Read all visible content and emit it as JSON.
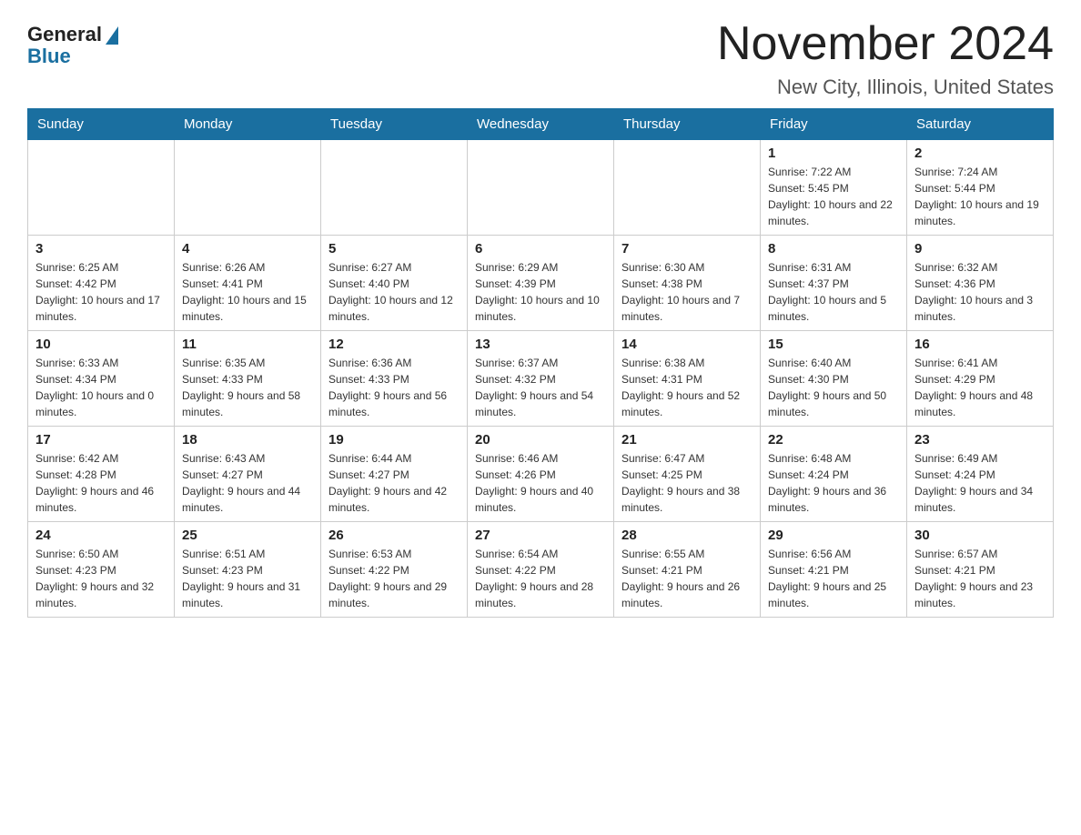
{
  "logo": {
    "general": "General",
    "blue": "Blue"
  },
  "title": "November 2024",
  "subtitle": "New City, Illinois, United States",
  "weekdays": [
    "Sunday",
    "Monday",
    "Tuesday",
    "Wednesday",
    "Thursday",
    "Friday",
    "Saturday"
  ],
  "weeks": [
    [
      {
        "day": "",
        "sunrise": "",
        "sunset": "",
        "daylight": "",
        "empty": true
      },
      {
        "day": "",
        "sunrise": "",
        "sunset": "",
        "daylight": "",
        "empty": true
      },
      {
        "day": "",
        "sunrise": "",
        "sunset": "",
        "daylight": "",
        "empty": true
      },
      {
        "day": "",
        "sunrise": "",
        "sunset": "",
        "daylight": "",
        "empty": true
      },
      {
        "day": "",
        "sunrise": "",
        "sunset": "",
        "daylight": "",
        "empty": true
      },
      {
        "day": "1",
        "sunrise": "Sunrise: 7:22 AM",
        "sunset": "Sunset: 5:45 PM",
        "daylight": "Daylight: 10 hours and 22 minutes.",
        "empty": false
      },
      {
        "day": "2",
        "sunrise": "Sunrise: 7:24 AM",
        "sunset": "Sunset: 5:44 PM",
        "daylight": "Daylight: 10 hours and 19 minutes.",
        "empty": false
      }
    ],
    [
      {
        "day": "3",
        "sunrise": "Sunrise: 6:25 AM",
        "sunset": "Sunset: 4:42 PM",
        "daylight": "Daylight: 10 hours and 17 minutes.",
        "empty": false
      },
      {
        "day": "4",
        "sunrise": "Sunrise: 6:26 AM",
        "sunset": "Sunset: 4:41 PM",
        "daylight": "Daylight: 10 hours and 15 minutes.",
        "empty": false
      },
      {
        "day": "5",
        "sunrise": "Sunrise: 6:27 AM",
        "sunset": "Sunset: 4:40 PM",
        "daylight": "Daylight: 10 hours and 12 minutes.",
        "empty": false
      },
      {
        "day": "6",
        "sunrise": "Sunrise: 6:29 AM",
        "sunset": "Sunset: 4:39 PM",
        "daylight": "Daylight: 10 hours and 10 minutes.",
        "empty": false
      },
      {
        "day": "7",
        "sunrise": "Sunrise: 6:30 AM",
        "sunset": "Sunset: 4:38 PM",
        "daylight": "Daylight: 10 hours and 7 minutes.",
        "empty": false
      },
      {
        "day": "8",
        "sunrise": "Sunrise: 6:31 AM",
        "sunset": "Sunset: 4:37 PM",
        "daylight": "Daylight: 10 hours and 5 minutes.",
        "empty": false
      },
      {
        "day": "9",
        "sunrise": "Sunrise: 6:32 AM",
        "sunset": "Sunset: 4:36 PM",
        "daylight": "Daylight: 10 hours and 3 minutes.",
        "empty": false
      }
    ],
    [
      {
        "day": "10",
        "sunrise": "Sunrise: 6:33 AM",
        "sunset": "Sunset: 4:34 PM",
        "daylight": "Daylight: 10 hours and 0 minutes.",
        "empty": false
      },
      {
        "day": "11",
        "sunrise": "Sunrise: 6:35 AM",
        "sunset": "Sunset: 4:33 PM",
        "daylight": "Daylight: 9 hours and 58 minutes.",
        "empty": false
      },
      {
        "day": "12",
        "sunrise": "Sunrise: 6:36 AM",
        "sunset": "Sunset: 4:33 PM",
        "daylight": "Daylight: 9 hours and 56 minutes.",
        "empty": false
      },
      {
        "day": "13",
        "sunrise": "Sunrise: 6:37 AM",
        "sunset": "Sunset: 4:32 PM",
        "daylight": "Daylight: 9 hours and 54 minutes.",
        "empty": false
      },
      {
        "day": "14",
        "sunrise": "Sunrise: 6:38 AM",
        "sunset": "Sunset: 4:31 PM",
        "daylight": "Daylight: 9 hours and 52 minutes.",
        "empty": false
      },
      {
        "day": "15",
        "sunrise": "Sunrise: 6:40 AM",
        "sunset": "Sunset: 4:30 PM",
        "daylight": "Daylight: 9 hours and 50 minutes.",
        "empty": false
      },
      {
        "day": "16",
        "sunrise": "Sunrise: 6:41 AM",
        "sunset": "Sunset: 4:29 PM",
        "daylight": "Daylight: 9 hours and 48 minutes.",
        "empty": false
      }
    ],
    [
      {
        "day": "17",
        "sunrise": "Sunrise: 6:42 AM",
        "sunset": "Sunset: 4:28 PM",
        "daylight": "Daylight: 9 hours and 46 minutes.",
        "empty": false
      },
      {
        "day": "18",
        "sunrise": "Sunrise: 6:43 AM",
        "sunset": "Sunset: 4:27 PM",
        "daylight": "Daylight: 9 hours and 44 minutes.",
        "empty": false
      },
      {
        "day": "19",
        "sunrise": "Sunrise: 6:44 AM",
        "sunset": "Sunset: 4:27 PM",
        "daylight": "Daylight: 9 hours and 42 minutes.",
        "empty": false
      },
      {
        "day": "20",
        "sunrise": "Sunrise: 6:46 AM",
        "sunset": "Sunset: 4:26 PM",
        "daylight": "Daylight: 9 hours and 40 minutes.",
        "empty": false
      },
      {
        "day": "21",
        "sunrise": "Sunrise: 6:47 AM",
        "sunset": "Sunset: 4:25 PM",
        "daylight": "Daylight: 9 hours and 38 minutes.",
        "empty": false
      },
      {
        "day": "22",
        "sunrise": "Sunrise: 6:48 AM",
        "sunset": "Sunset: 4:24 PM",
        "daylight": "Daylight: 9 hours and 36 minutes.",
        "empty": false
      },
      {
        "day": "23",
        "sunrise": "Sunrise: 6:49 AM",
        "sunset": "Sunset: 4:24 PM",
        "daylight": "Daylight: 9 hours and 34 minutes.",
        "empty": false
      }
    ],
    [
      {
        "day": "24",
        "sunrise": "Sunrise: 6:50 AM",
        "sunset": "Sunset: 4:23 PM",
        "daylight": "Daylight: 9 hours and 32 minutes.",
        "empty": false
      },
      {
        "day": "25",
        "sunrise": "Sunrise: 6:51 AM",
        "sunset": "Sunset: 4:23 PM",
        "daylight": "Daylight: 9 hours and 31 minutes.",
        "empty": false
      },
      {
        "day": "26",
        "sunrise": "Sunrise: 6:53 AM",
        "sunset": "Sunset: 4:22 PM",
        "daylight": "Daylight: 9 hours and 29 minutes.",
        "empty": false
      },
      {
        "day": "27",
        "sunrise": "Sunrise: 6:54 AM",
        "sunset": "Sunset: 4:22 PM",
        "daylight": "Daylight: 9 hours and 28 minutes.",
        "empty": false
      },
      {
        "day": "28",
        "sunrise": "Sunrise: 6:55 AM",
        "sunset": "Sunset: 4:21 PM",
        "daylight": "Daylight: 9 hours and 26 minutes.",
        "empty": false
      },
      {
        "day": "29",
        "sunrise": "Sunrise: 6:56 AM",
        "sunset": "Sunset: 4:21 PM",
        "daylight": "Daylight: 9 hours and 25 minutes.",
        "empty": false
      },
      {
        "day": "30",
        "sunrise": "Sunrise: 6:57 AM",
        "sunset": "Sunset: 4:21 PM",
        "daylight": "Daylight: 9 hours and 23 minutes.",
        "empty": false
      }
    ]
  ]
}
